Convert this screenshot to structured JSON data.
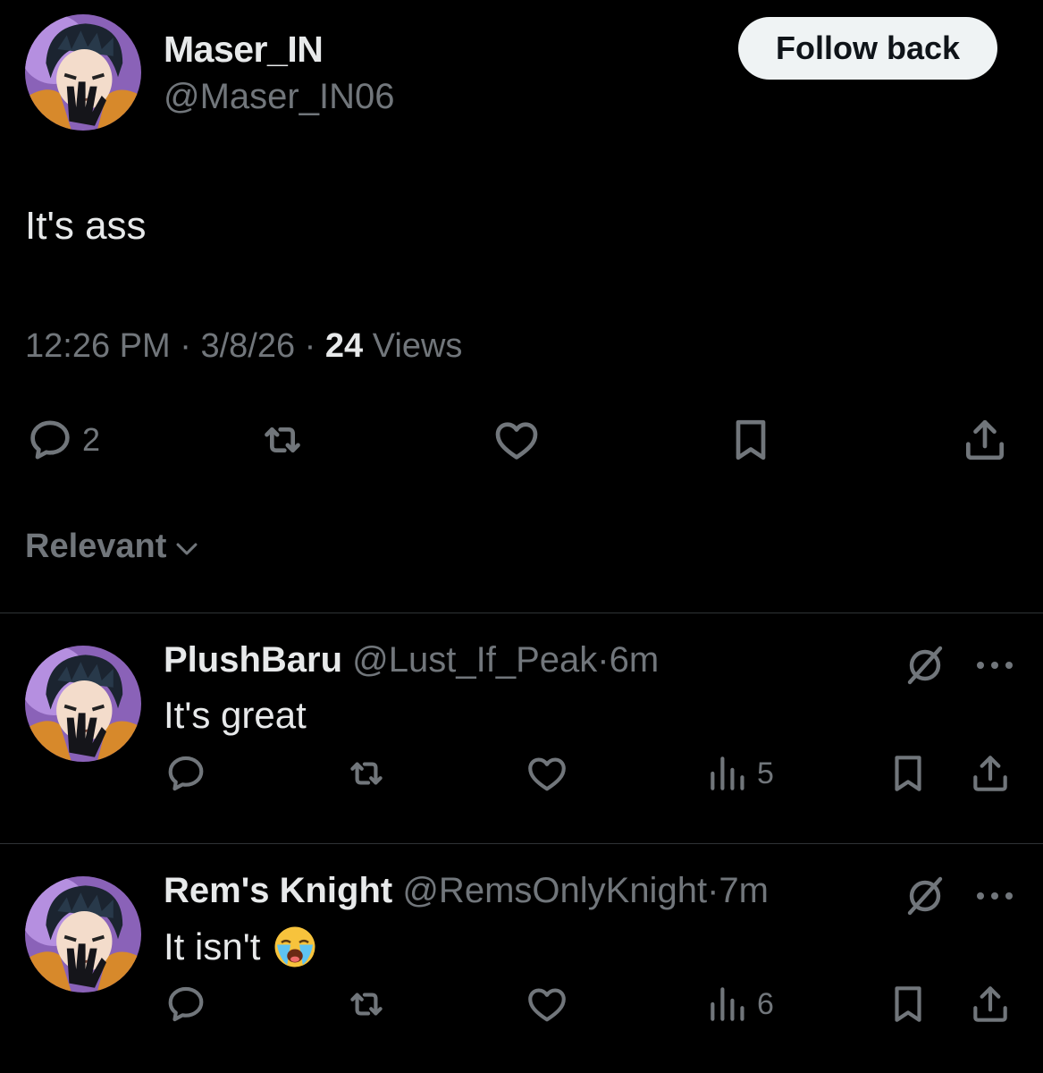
{
  "main_tweet": {
    "author_name": "Maser_IN",
    "author_handle": "@Maser_IN06",
    "follow_button_label": "Follow back",
    "text": "It's ass",
    "time": "12:26 PM",
    "sep1": " · ",
    "date": "3/8/26",
    "sep2": " · ",
    "views_count": "24",
    "views_label": " Views",
    "reply_count": "2",
    "icons": [
      "reply-icon",
      "retweet-icon",
      "like-icon",
      "bookmark-icon",
      "share-icon"
    ]
  },
  "sort": {
    "label": "Relevant"
  },
  "replies": [
    {
      "author_name": "PlushBaru",
      "author_handle": "@Lust_If_Peak",
      "separator": "·",
      "time": "6m",
      "text": "It's great",
      "emoji": "",
      "views": "5",
      "icons": [
        "grok-icon",
        "more-icon",
        "reply-icon",
        "retweet-icon",
        "like-icon",
        "views-icon",
        "bookmark-icon",
        "share-icon"
      ]
    },
    {
      "author_name": "Rem's Knight",
      "author_handle": "@RemsOnlyKnight",
      "separator": "·",
      "time": "7m",
      "text": "It isn't",
      "emoji": "loudly-crying-face",
      "views": "6",
      "icons": [
        "grok-icon",
        "more-icon",
        "reply-icon",
        "retweet-icon",
        "like-icon",
        "views-icon",
        "bookmark-icon",
        "share-icon"
      ]
    }
  ],
  "colors": {
    "background": "#000000",
    "primary_text": "#e7e9ea",
    "secondary_text": "#71767b",
    "divider": "#2f3336",
    "follow_button_bg": "#eff3f4",
    "follow_button_text": "#0f1419"
  }
}
